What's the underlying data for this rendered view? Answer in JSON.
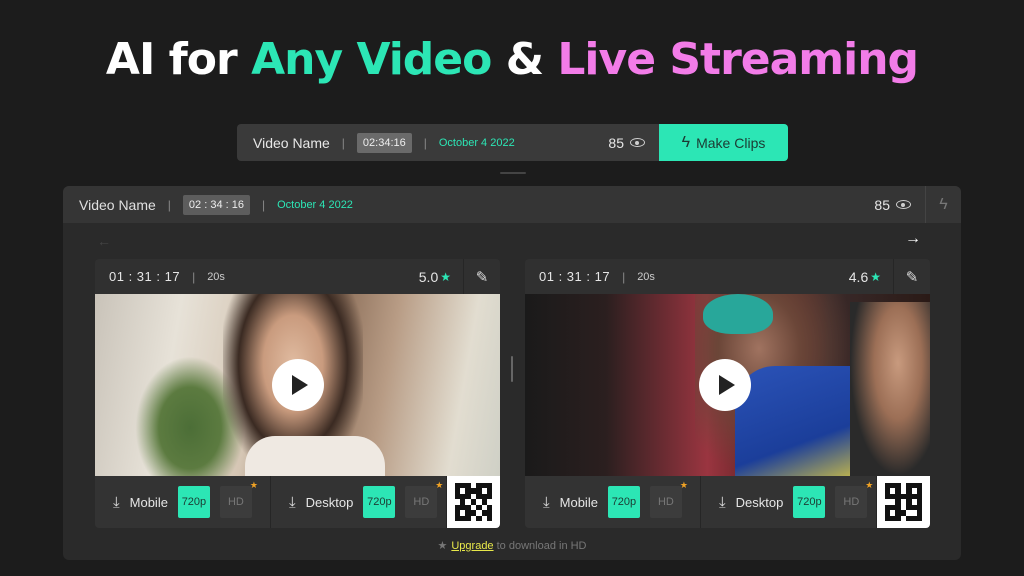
{
  "hero": {
    "part1": "AI for ",
    "part2": "Any Video",
    "part3": " & ",
    "part4": "Live Streaming"
  },
  "topbar": {
    "video_name": "Video Name",
    "duration": "02:34:16",
    "date": "October 4 2022",
    "views": "85",
    "make_clips": "Make Clips",
    "bolt_icon": "lightning-icon",
    "eye_icon": "eye-icon"
  },
  "panel": {
    "video_name": "Video Name",
    "duration": "02 : 34 : 16",
    "date": "October 4 2022",
    "views": "85",
    "left_arrow": "←",
    "right_arrow": "→"
  },
  "clips": [
    {
      "start": "01 : 31 : 17",
      "length": "20s",
      "rating": "5.0",
      "mobile_label": "Mobile",
      "desktop_label": "Desktop",
      "res_on": "720p",
      "res_off": "HD"
    },
    {
      "start": "01 : 31 : 17",
      "length": "20s",
      "rating": "4.6",
      "mobile_label": "Mobile",
      "desktop_label": "Desktop",
      "res_on": "720p",
      "res_off": "HD"
    }
  ],
  "footer": {
    "upgrade_link": "Upgrade",
    "upgrade_rest": " to download in HD"
  },
  "colors": {
    "accent": "#2ce6b5",
    "pink": "#f27ce8",
    "gold": "#f0a224"
  }
}
